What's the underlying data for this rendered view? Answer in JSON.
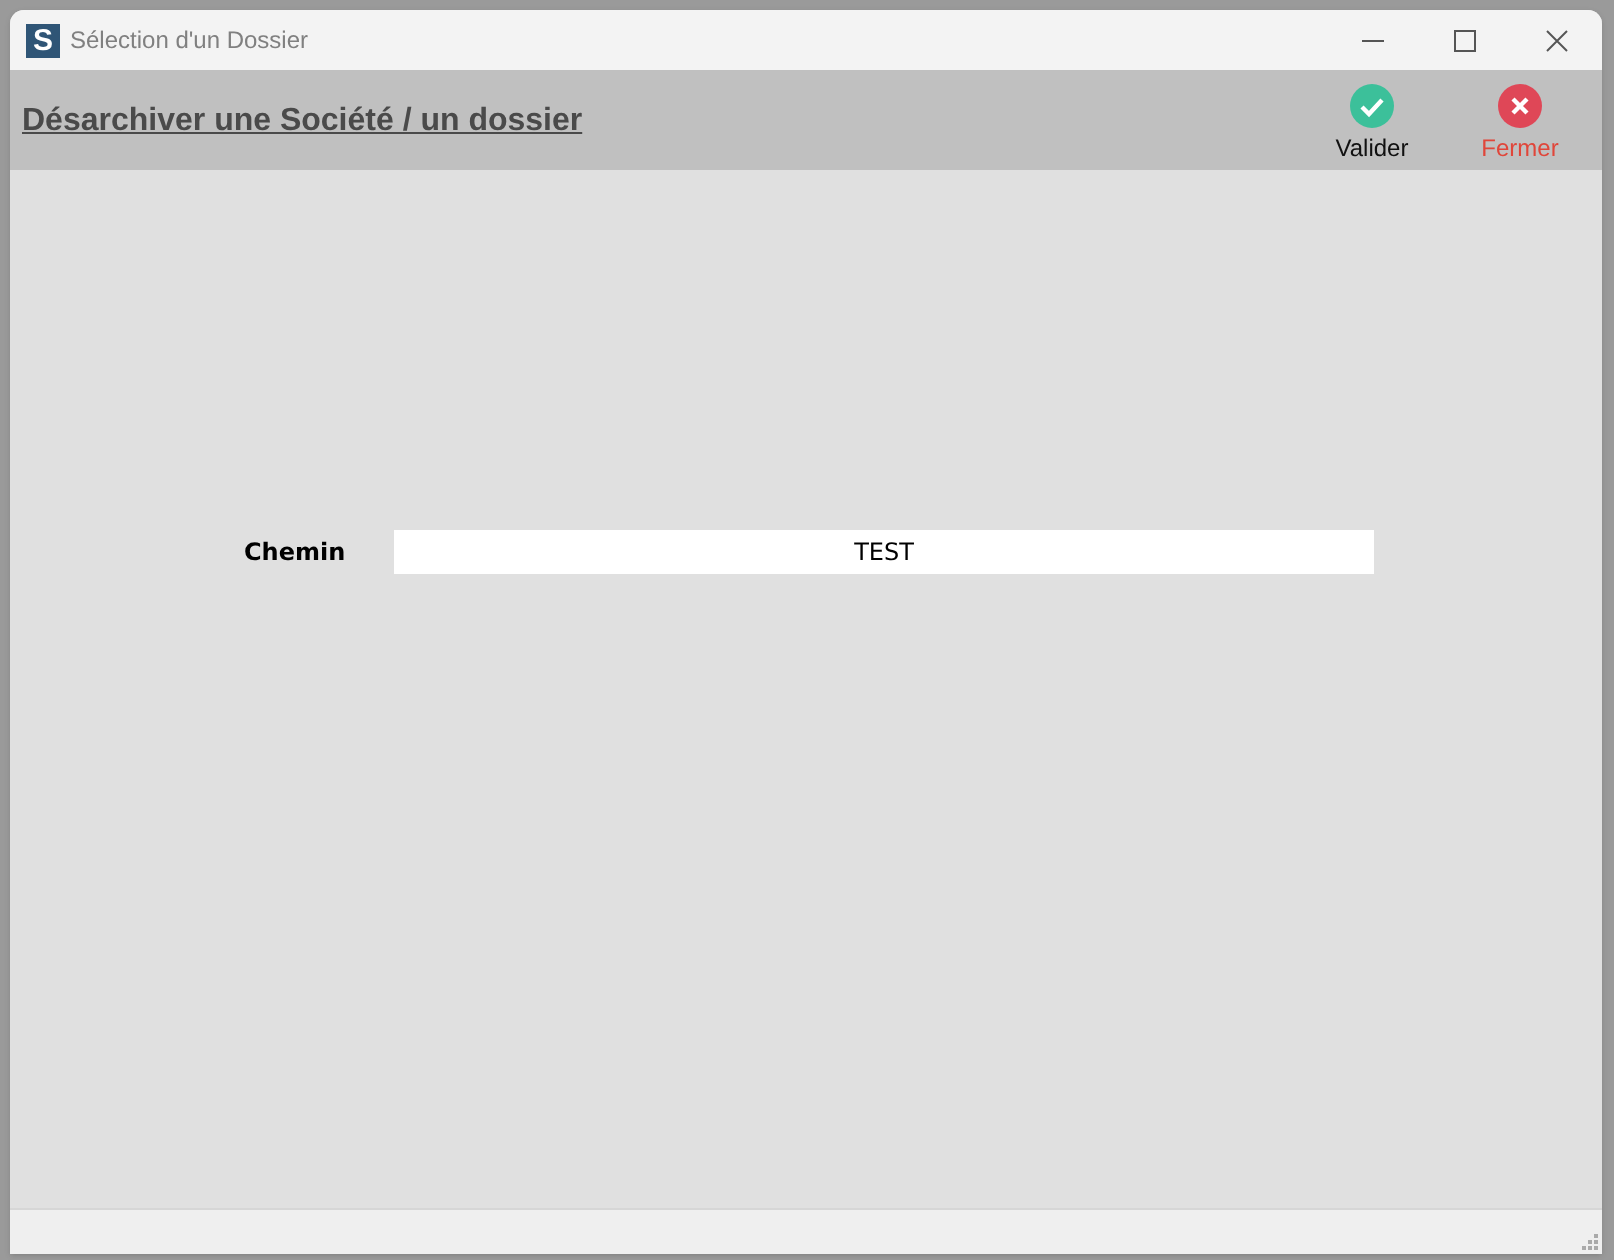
{
  "window": {
    "logo": "S",
    "title": "Sélection d'un Dossier"
  },
  "header": {
    "title": "Désarchiver une Société / un dossier",
    "actions": [
      {
        "label": "Valider",
        "kind": "confirm"
      },
      {
        "label": "Fermer",
        "kind": "close"
      }
    ]
  },
  "form": {
    "label": "Chemin",
    "value": "TEST"
  }
}
